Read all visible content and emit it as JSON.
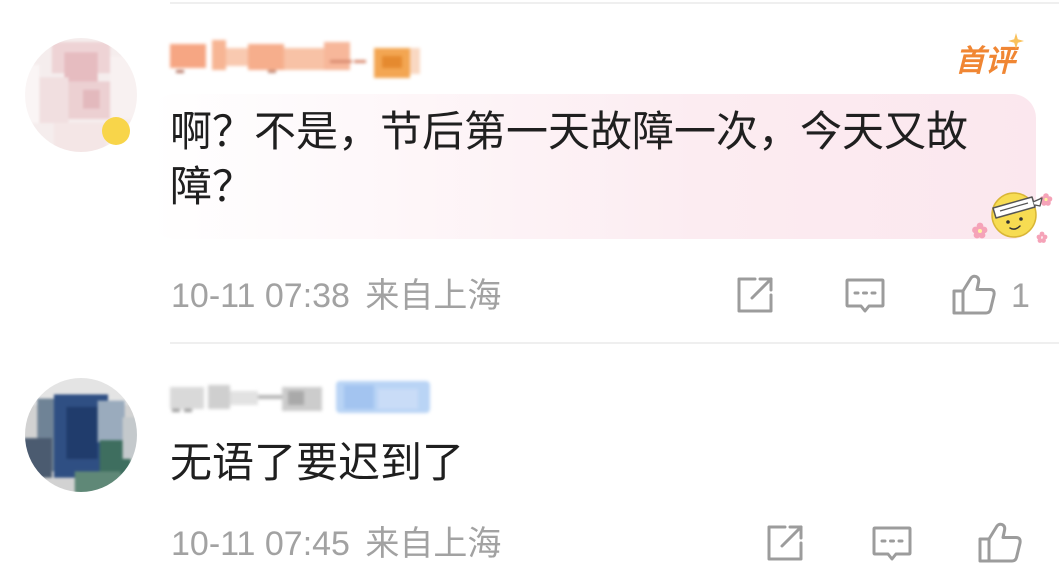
{
  "colors": {
    "text": "#1f1f1f",
    "meta": "#a2a2a2",
    "icon": "#9c9c9c",
    "first_comment_badge": "#f08633",
    "divider": "#efefef",
    "bubble": "#fcecf1"
  },
  "icons": {
    "repost": "repost-icon",
    "comment": "comment-icon",
    "like": "thumbs-up-icon"
  },
  "comments": [
    {
      "badge": "首评",
      "text": "啊？不是，节后第一天故障一次，今天又故障？",
      "time": "10-11 07:38",
      "location": "来自上海",
      "like_count": "1"
    },
    {
      "text": "无语了要迟到了",
      "time": "10-11 07:45",
      "location": "来自上海"
    }
  ]
}
